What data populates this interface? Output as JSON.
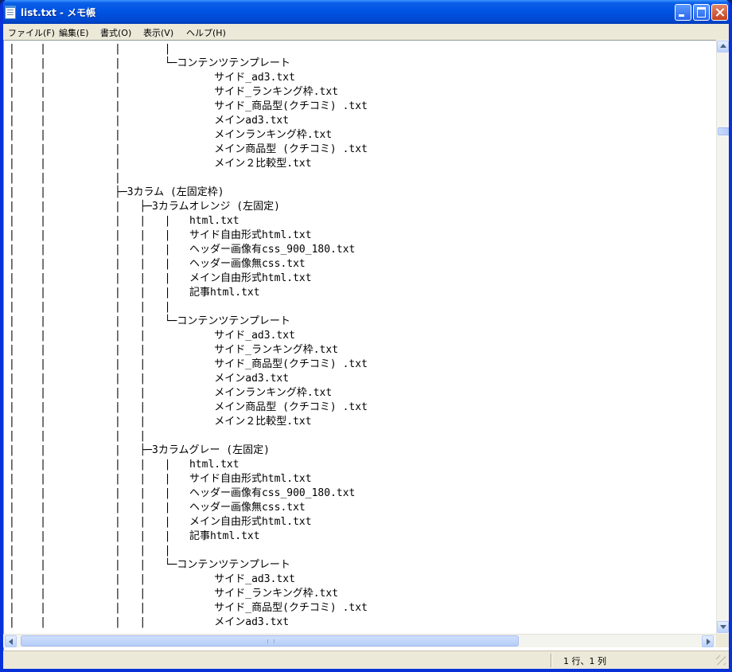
{
  "window": {
    "title": "list.txt - メモ帳"
  },
  "menu": [
    "ファイル(F)",
    "編集(E)",
    "書式(O)",
    "表示(V)",
    "ヘルプ(H)"
  ],
  "editor": {
    "lines": [
      "|    |           |       |",
      "|    |           |       └─コンテンツテンプレート",
      "|    |           |               サイド_ad3.txt",
      "|    |           |               サイド_ランキング枠.txt",
      "|    |           |               サイド_商品型(クチコミ) .txt",
      "|    |           |               メインad3.txt",
      "|    |           |               メインランキング枠.txt",
      "|    |           |               メイン商品型 (クチコミ) .txt",
      "|    |           |               メイン２比較型.txt",
      "|    |           |",
      "|    |           ├─3カラム (左固定枠)",
      "|    |           |   ├─3カラムオレンジ (左固定)",
      "|    |           |   |   |   html.txt",
      "|    |           |   |   |   サイド自由形式html.txt",
      "|    |           |   |   |   ヘッダー画像有css_900_180.txt",
      "|    |           |   |   |   ヘッダー画像無css.txt",
      "|    |           |   |   |   メイン自由形式html.txt",
      "|    |           |   |   |   記事html.txt",
      "|    |           |   |   |",
      "|    |           |   |   └─コンテンツテンプレート",
      "|    |           |   |           サイド_ad3.txt",
      "|    |           |   |           サイド_ランキング枠.txt",
      "|    |           |   |           サイド_商品型(クチコミ) .txt",
      "|    |           |   |           メインad3.txt",
      "|    |           |   |           メインランキング枠.txt",
      "|    |           |   |           メイン商品型 (クチコミ) .txt",
      "|    |           |   |           メイン２比較型.txt",
      "|    |           |   |",
      "|    |           |   ├─3カラムグレー (左固定)",
      "|    |           |   |   |   html.txt",
      "|    |           |   |   |   サイド自由形式html.txt",
      "|    |           |   |   |   ヘッダー画像有css_900_180.txt",
      "|    |           |   |   |   ヘッダー画像無css.txt",
      "|    |           |   |   |   メイン自由形式html.txt",
      "|    |           |   |   |   記事html.txt",
      "|    |           |   |   |",
      "|    |           |   |   └─コンテンツテンプレート",
      "|    |           |   |           サイド_ad3.txt",
      "|    |           |   |           サイド_ランキング枠.txt",
      "|    |           |   |           サイド_商品型(クチコミ) .txt",
      "|    |           |   |           メインad3.txt"
    ]
  },
  "status": {
    "position": "1 行、1 列"
  }
}
